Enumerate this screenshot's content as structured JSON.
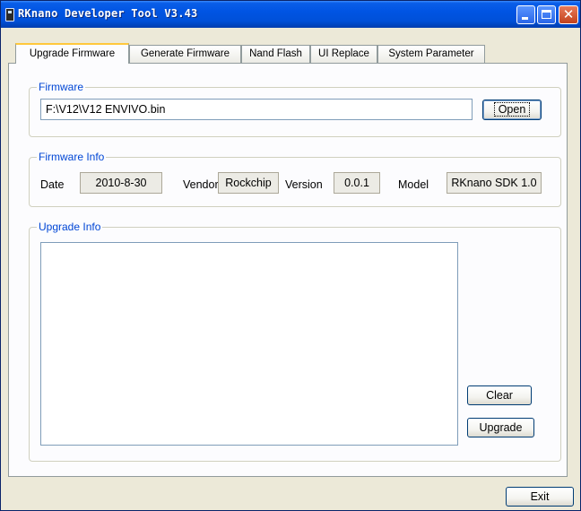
{
  "window": {
    "title": "RKnano Developer Tool V3.43"
  },
  "tabs": [
    "Upgrade Firmware",
    "Generate Firmware",
    "Nand Flash",
    "UI Replace",
    "System Parameter"
  ],
  "firmware": {
    "group_title": "Firmware",
    "path": "F:\\V12\\V12 ENVIVO.bin",
    "open_label": "Open"
  },
  "firmware_info": {
    "group_title": "Firmware Info",
    "date_label": "Date",
    "date": "2010-8-30",
    "vendor_label": "Vendor",
    "vendor": "Rockchip",
    "version_label": "Version",
    "version": "0.0.1",
    "model_label": "Model",
    "model": "RKnano SDK 1.0"
  },
  "upgrade_info": {
    "group_title": "Upgrade Info",
    "log": "",
    "clear_label": "Clear",
    "upgrade_label": "Upgrade"
  },
  "footer": {
    "exit_label": "Exit"
  }
}
